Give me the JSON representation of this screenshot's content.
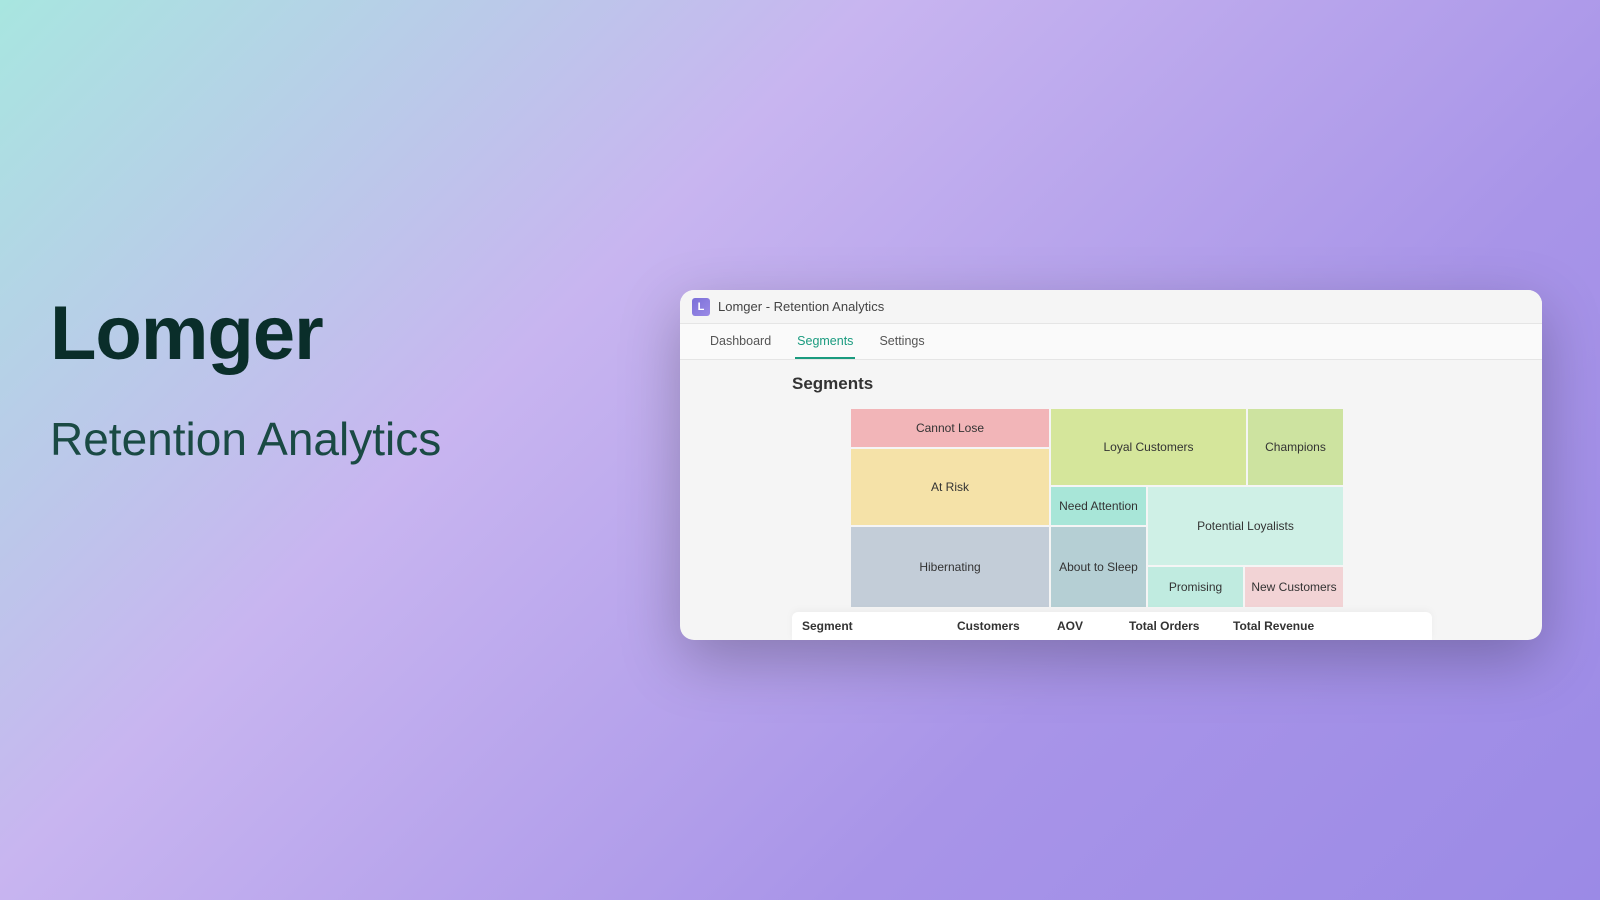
{
  "hero": {
    "title": "Lomger",
    "subtitle": "Retention Analytics"
  },
  "window": {
    "logo_letter": "L",
    "title": "Lomger - Retention Analytics",
    "nav": [
      {
        "label": "Dashboard",
        "active": false
      },
      {
        "label": "Segments",
        "active": true
      },
      {
        "label": "Settings",
        "active": false
      }
    ],
    "section_title": "Segments",
    "segments": {
      "cannot_lose": "Cannot Lose",
      "at_risk": "At Risk",
      "hibernating": "Hibernating",
      "loyal_customers": "Loyal Customers",
      "champions": "Champions",
      "need_attention": "Need Attention",
      "about_to_sleep": "About to Sleep",
      "potential_loyalists": "Potential Loyalists",
      "promising": "Promising",
      "new_customers": "New Customers"
    },
    "table_headers": {
      "segment": "Segment",
      "customers": "Customers",
      "aov": "AOV",
      "total_orders": "Total Orders",
      "total_revenue": "Total Revenue"
    }
  },
  "colors": {
    "accent": "#1a9b7f",
    "cannot_lose": "#f2b5b8",
    "at_risk": "#f5e2a8",
    "hibernating": "#c3cdd8",
    "loyal_customers": "#d5e69b",
    "champions": "#cde3a0",
    "need_attention": "#a8e6d8",
    "about_to_sleep": "#b5cfd4",
    "potential_loyalists": "#cff0e6",
    "promising": "#c0ebe0",
    "new_customers": "#f2d3d5"
  }
}
